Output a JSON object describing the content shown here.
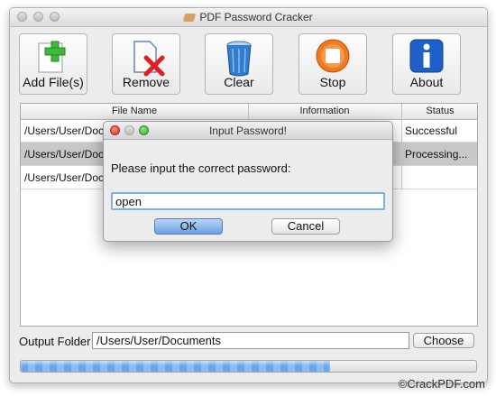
{
  "window": {
    "title": "PDF Password Cracker"
  },
  "toolbar": {
    "add_label": "Add File(s)",
    "remove_label": "Remove",
    "clear_label": "Clear",
    "stop_label": "Stop",
    "about_label": "About"
  },
  "table": {
    "columns": [
      "File Name",
      "Information",
      "Status"
    ],
    "rows": [
      {
        "file": "/Users/User/Doc",
        "info": "",
        "status": "Successful"
      },
      {
        "file": "/Users/User/Doc",
        "info": "",
        "status": "Processing..."
      },
      {
        "file": "/Users/User/Doc",
        "info": "",
        "status": ""
      }
    ]
  },
  "output": {
    "label": "Output Folder",
    "path": "/Users/User/Documents",
    "choose_label": "Choose"
  },
  "progress": {
    "fraction": 0.68
  },
  "dialog": {
    "title": "Input Password!",
    "message": "Please input the correct  password:",
    "password": "open",
    "ok_label": "OK",
    "cancel_label": "Cancel"
  },
  "watermark": "©CrackPDF.com",
  "colors": {
    "accent_blue": "#6aa1e2",
    "add_green": "#3cb83c",
    "remove_red": "#e02020",
    "stop_orange": "#f07a20",
    "about_blue": "#1e5fc8"
  }
}
